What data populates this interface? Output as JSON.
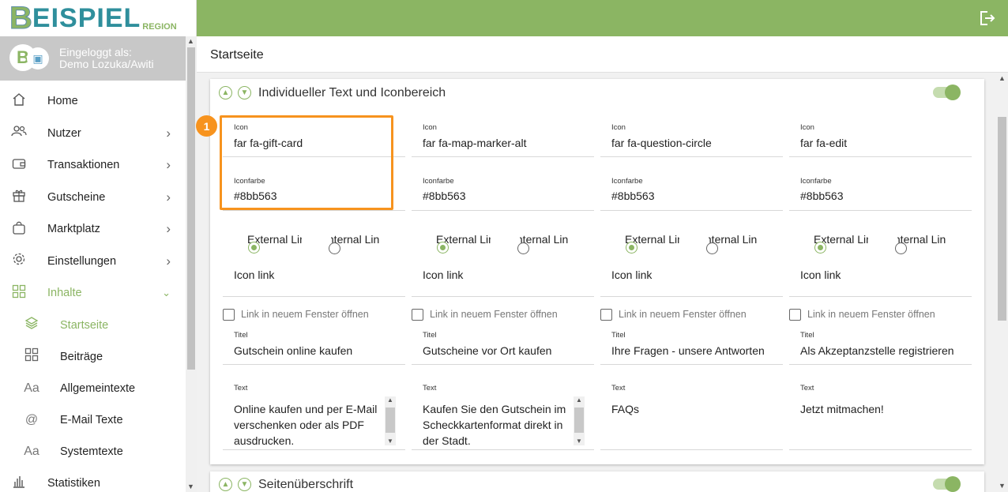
{
  "logo": {
    "first": "B",
    "rest": "EISPIEL",
    "region": "REGION"
  },
  "user": {
    "line1": "Eingeloggt als:",
    "line2": "Demo Lozuka/Awiti",
    "avatar_letter": "B"
  },
  "nav": {
    "items": [
      {
        "label": "Home",
        "icon": "home-icon"
      },
      {
        "label": "Nutzer",
        "icon": "users-icon"
      },
      {
        "label": "Transaktionen",
        "icon": "wallet-icon"
      },
      {
        "label": "Gutscheine",
        "icon": "gift-icon"
      },
      {
        "label": "Marktplatz",
        "icon": "shopping-bag-icon"
      },
      {
        "label": "Einstellungen",
        "icon": "gear-icon"
      },
      {
        "label": "Inhalte",
        "icon": "grid-icon"
      }
    ],
    "sub": [
      {
        "label": "Startseite",
        "icon": "layers-icon"
      },
      {
        "label": "Beiträge",
        "icon": "grid-icon"
      },
      {
        "label": "Allgemeintexte",
        "icon": "Aa"
      },
      {
        "label": "E-Mail Texte",
        "icon": "@"
      },
      {
        "label": "Systemtexte",
        "icon": "Aa"
      }
    ],
    "last": {
      "label": "Statistiken",
      "icon": "bar-chart-icon"
    }
  },
  "page_title": "Startseite",
  "section": {
    "title": "Individueller Text und Iconbereich",
    "section2_title": "Seitenüberschrift",
    "labels": {
      "icon": "Icon",
      "iconfarbe": "Iconfarbe",
      "external": "External Link",
      "internal": "Internal Link",
      "icon_link": "Icon link",
      "new_window": "Link in neuem Fenster öffnen",
      "titel": "Titel",
      "text": "Text"
    },
    "columns": [
      {
        "icon": "far fa-gift-card",
        "color": "#8bb563",
        "title": "Gutschein online kaufen",
        "text": "Online kaufen und per E-Mail verschenken oder als PDF ausdrucken."
      },
      {
        "icon": "far fa-map-marker-alt",
        "color": "#8bb563",
        "title": "Gutscheine vor Ort kaufen",
        "text": "Kaufen Sie den Gutschein im Scheckkartenformat direkt in der Stadt."
      },
      {
        "icon": "far fa-question-circle",
        "color": "#8bb563",
        "title": "Ihre Fragen - unsere Antworten",
        "text": "FAQs"
      },
      {
        "icon": "far fa-edit",
        "color": "#8bb563",
        "title": "Als Akzeptanzstelle registrieren",
        "text": "Jetzt mitmachen!"
      }
    ]
  },
  "annotation": {
    "number": "1",
    "color": "#f7931e"
  },
  "colors": {
    "accent": "#8bb563",
    "topbar": "#8bb563",
    "highlight": "#f7931e"
  }
}
